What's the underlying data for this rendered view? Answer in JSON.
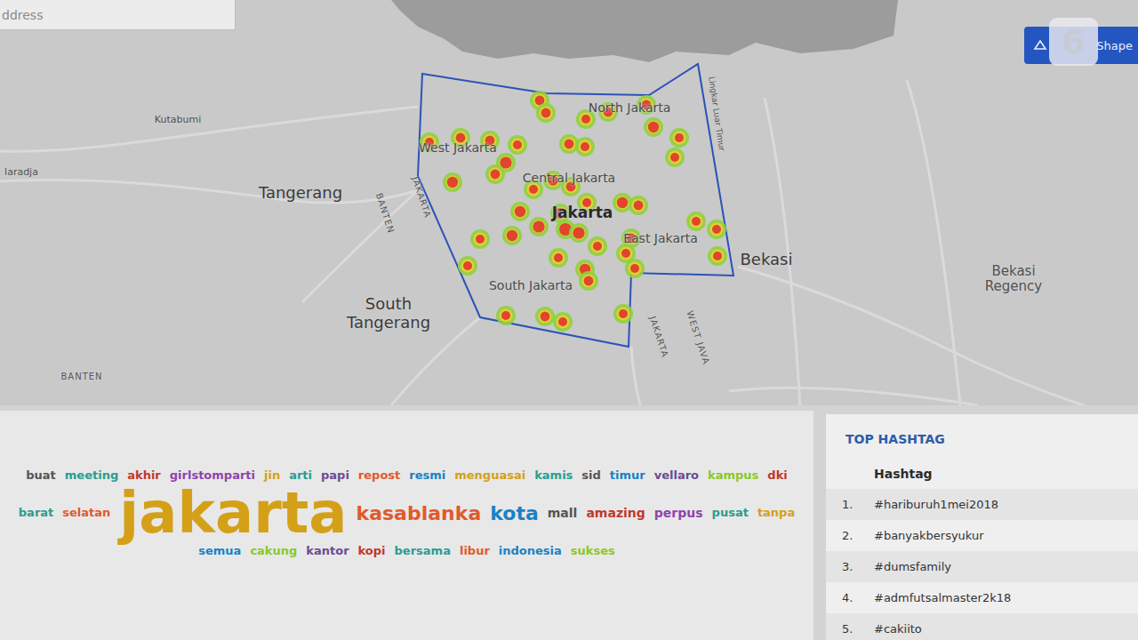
{
  "search": {
    "placeholder": "ddress"
  },
  "draw_button": {
    "label": "Shape"
  },
  "watermark": {
    "text": "6"
  },
  "map": {
    "labels": [
      {
        "text": "North Jakarta",
        "kind": "district",
        "lng": 106.933,
        "lat": -6.136
      },
      {
        "text": "West Jakarta",
        "kind": "district",
        "lng": 106.74,
        "lat": -6.181
      },
      {
        "text": "Central Jakarta",
        "kind": "district",
        "lng": 106.865,
        "lat": -6.215
      },
      {
        "text": "Jakarta",
        "kind": "core",
        "lng": 106.88,
        "lat": -6.255
      },
      {
        "text": "East Jakarta",
        "kind": "district",
        "lng": 106.968,
        "lat": -6.283
      },
      {
        "text": "South Jakarta",
        "kind": "district",
        "lng": 106.822,
        "lat": -6.336
      },
      {
        "text": "Tangerang",
        "kind": "city",
        "lng": 106.563,
        "lat": -6.232
      },
      {
        "text": "South Tangerang",
        "kind": "city",
        "lng": 106.662,
        "lat": -6.368
      },
      {
        "text": "Bekasi",
        "kind": "city",
        "lng": 107.087,
        "lat": -6.307
      },
      {
        "text": "Bekasi Regency",
        "kind": "regency",
        "lng": 107.365,
        "lat": -6.329
      },
      {
        "text": "Kutabumi",
        "kind": "town",
        "lng": 106.425,
        "lat": -6.15
      },
      {
        "text": "laradja",
        "kind": "town",
        "lng": 106.249,
        "lat": -6.209
      },
      {
        "text": "BANTEN",
        "kind": "boundary",
        "lng": 106.658,
        "lat": -6.255
      },
      {
        "text": "BANTEN",
        "kind": "region",
        "lng": 106.317,
        "lat": -6.439
      },
      {
        "text": "JAKARTA",
        "kind": "boundary",
        "lng": 106.699,
        "lat": -6.237
      },
      {
        "text": "JAKARTA",
        "kind": "boundary",
        "lng": 106.966,
        "lat": -6.394
      },
      {
        "text": "WEST JAVA",
        "kind": "boundary",
        "lng": 107.01,
        "lat": -6.395
      },
      {
        "text": "Lingkar Luar Timur",
        "kind": "road",
        "lng": 107.031,
        "lat": -6.143
      }
    ],
    "boundary": [
      [
        106.7,
        -6.098
      ],
      [
        106.84,
        -6.12
      ],
      [
        106.955,
        -6.122
      ],
      [
        107.01,
        -6.087
      ],
      [
        107.05,
        -6.325
      ],
      [
        106.935,
        -6.322
      ],
      [
        106.932,
        -6.405
      ],
      [
        106.765,
        -6.372
      ],
      [
        106.695,
        -6.213
      ]
    ],
    "heat_points": [
      {
        "lng": 106.832,
        "lat": -6.128,
        "intensity": 0.6
      },
      {
        "lng": 106.839,
        "lat": -6.142,
        "intensity": 0.6
      },
      {
        "lng": 106.884,
        "lat": -6.149,
        "intensity": 0.5
      },
      {
        "lng": 106.909,
        "lat": -6.141,
        "intensity": 0.6
      },
      {
        "lng": 106.952,
        "lat": -6.133,
        "intensity": 0.6
      },
      {
        "lng": 106.96,
        "lat": -6.158,
        "intensity": 0.8
      },
      {
        "lng": 106.989,
        "lat": -6.17,
        "intensity": 0.5
      },
      {
        "lng": 106.984,
        "lat": -6.192,
        "intensity": 0.5
      },
      {
        "lng": 106.708,
        "lat": -6.175,
        "intensity": 0.5
      },
      {
        "lng": 106.743,
        "lat": -6.17,
        "intensity": 0.6
      },
      {
        "lng": 106.776,
        "lat": -6.173,
        "intensity": 0.6
      },
      {
        "lng": 106.807,
        "lat": -6.178,
        "intensity": 0.5
      },
      {
        "lng": 106.794,
        "lat": -6.198,
        "intensity": 0.9
      },
      {
        "lng": 106.782,
        "lat": -6.211,
        "intensity": 0.6
      },
      {
        "lng": 106.734,
        "lat": -6.22,
        "intensity": 0.8
      },
      {
        "lng": 106.865,
        "lat": -6.177,
        "intensity": 0.6
      },
      {
        "lng": 106.883,
        "lat": -6.18,
        "intensity": 0.5
      },
      {
        "lng": 106.825,
        "lat": -6.228,
        "intensity": 0.5
      },
      {
        "lng": 106.847,
        "lat": -6.218,
        "intensity": 0.7
      },
      {
        "lng": 106.867,
        "lat": -6.225,
        "intensity": 0.6
      },
      {
        "lng": 106.885,
        "lat": -6.243,
        "intensity": 0.5
      },
      {
        "lng": 106.925,
        "lat": -6.243,
        "intensity": 0.8
      },
      {
        "lng": 106.943,
        "lat": -6.246,
        "intensity": 0.6
      },
      {
        "lng": 106.81,
        "lat": -6.253,
        "intensity": 0.8
      },
      {
        "lng": 106.831,
        "lat": -6.27,
        "intensity": 0.9
      },
      {
        "lng": 106.855,
        "lat": -6.255,
        "intensity": 0.8
      },
      {
        "lng": 106.861,
        "lat": -6.273,
        "intensity": 1.0
      },
      {
        "lng": 106.876,
        "lat": -6.277,
        "intensity": 0.9
      },
      {
        "lng": 106.801,
        "lat": -6.28,
        "intensity": 0.8
      },
      {
        "lng": 106.765,
        "lat": -6.284,
        "intensity": 0.5
      },
      {
        "lng": 106.897,
        "lat": -6.292,
        "intensity": 0.5
      },
      {
        "lng": 106.935,
        "lat": -6.283,
        "intensity": 0.6
      },
      {
        "lng": 106.929,
        "lat": -6.3,
        "intensity": 0.5
      },
      {
        "lng": 107.008,
        "lat": -6.264,
        "intensity": 0.5
      },
      {
        "lng": 107.031,
        "lat": -6.273,
        "intensity": 0.5
      },
      {
        "lng": 107.032,
        "lat": -6.303,
        "intensity": 0.5
      },
      {
        "lng": 106.853,
        "lat": -6.305,
        "intensity": 0.5
      },
      {
        "lng": 106.883,
        "lat": -6.318,
        "intensity": 0.8
      },
      {
        "lng": 106.887,
        "lat": -6.331,
        "intensity": 0.6
      },
      {
        "lng": 106.939,
        "lat": -6.317,
        "intensity": 0.5
      },
      {
        "lng": 106.751,
        "lat": -6.314,
        "intensity": 0.5
      },
      {
        "lng": 106.794,
        "lat": -6.37,
        "intensity": 0.5
      },
      {
        "lng": 106.838,
        "lat": -6.371,
        "intensity": 0.6
      },
      {
        "lng": 106.858,
        "lat": -6.377,
        "intensity": 0.5
      },
      {
        "lng": 106.926,
        "lat": -6.368,
        "intensity": 0.5
      }
    ]
  },
  "word_cloud": {
    "words": [
      {
        "text": "buat",
        "weight": 0.05,
        "color": "#555555"
      },
      {
        "text": "meeting",
        "weight": 0.05,
        "color": "#2a9d8f"
      },
      {
        "text": "akhir",
        "weight": 0.06,
        "color": "#c0392b"
      },
      {
        "text": "girlstomparti",
        "weight": 0.05,
        "color": "#8e44ad"
      },
      {
        "text": "jin",
        "weight": 0.05,
        "color": "#d4a017"
      },
      {
        "text": "arti",
        "weight": 0.05,
        "color": "#2a9d8f"
      },
      {
        "text": "papi",
        "weight": 0.06,
        "color": "#6a4c93"
      },
      {
        "text": "repost",
        "weight": 0.05,
        "color": "#e05a2b"
      },
      {
        "text": "resmi",
        "weight": 0.05,
        "color": "#1982c4"
      },
      {
        "text": "menguasai",
        "weight": 0.05,
        "color": "#d4a017"
      },
      {
        "text": "kamis",
        "weight": 0.05,
        "color": "#2a9d8f"
      },
      {
        "text": "sid",
        "weight": 0.05,
        "color": "#555555"
      },
      {
        "text": "timur",
        "weight": 0.06,
        "color": "#1982c4"
      },
      {
        "text": "vellaro",
        "weight": 0.05,
        "color": "#6a4c93"
      },
      {
        "text": "kampus",
        "weight": 0.05,
        "color": "#8ac926"
      },
      {
        "text": "dki",
        "weight": 0.06,
        "color": "#c0392b"
      },
      {
        "text": "barat",
        "weight": 0.05,
        "color": "#2a9d8f"
      },
      {
        "text": "selatan",
        "weight": 0.05,
        "color": "#e05a2b"
      },
      {
        "text": "jakarta",
        "weight": 1.0,
        "color": "#d4a017"
      },
      {
        "text": "kasablanka",
        "weight": 0.22,
        "color": "#e05a2b"
      },
      {
        "text": "kota",
        "weight": 0.22,
        "color": "#1982c4"
      },
      {
        "text": "mall",
        "weight": 0.07,
        "color": "#555555"
      },
      {
        "text": "amazing",
        "weight": 0.07,
        "color": "#c0392b"
      },
      {
        "text": "perpus",
        "weight": 0.07,
        "color": "#8e44ad"
      },
      {
        "text": "pusat",
        "weight": 0.05,
        "color": "#2a9d8f"
      },
      {
        "text": "tanpa",
        "weight": 0.05,
        "color": "#d4a017"
      },
      {
        "text": "semua",
        "weight": 0.05,
        "color": "#1982c4"
      },
      {
        "text": "cakung",
        "weight": 0.05,
        "color": "#8ac926"
      },
      {
        "text": "kantor",
        "weight": 0.05,
        "color": "#6a4c93"
      },
      {
        "text": "kopi",
        "weight": 0.05,
        "color": "#c0392b"
      },
      {
        "text": "bersama",
        "weight": 0.05,
        "color": "#2a9d8f"
      },
      {
        "text": "libur",
        "weight": 0.05,
        "color": "#e05a2b"
      },
      {
        "text": "indonesia",
        "weight": 0.05,
        "color": "#1982c4"
      },
      {
        "text": "sukses",
        "weight": 0.05,
        "color": "#8ac926"
      }
    ]
  },
  "top_hashtag": {
    "title": "TOP HASHTAG",
    "column": "Hashtag",
    "rows": [
      {
        "rank": "1.",
        "tag": "#hariburuh1mei2018"
      },
      {
        "rank": "2.",
        "tag": "#banyakbersyukur"
      },
      {
        "rank": "3.",
        "tag": "#dumsfamily"
      },
      {
        "rank": "4.",
        "tag": "#admfutsalmaster2k18"
      },
      {
        "rank": "5.",
        "tag": "#cakiito"
      }
    ]
  }
}
